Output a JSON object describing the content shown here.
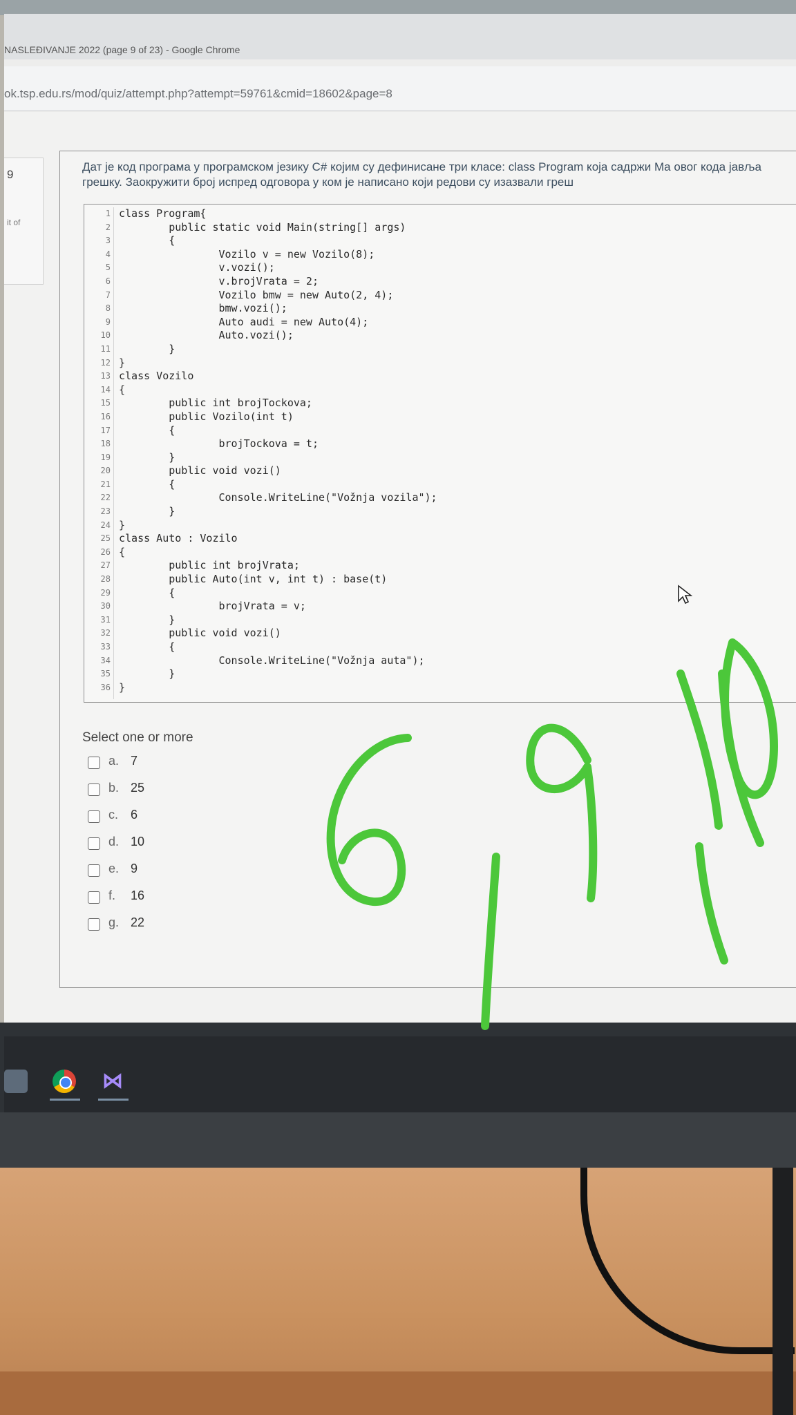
{
  "browser": {
    "title": "NASLEĐIVANJE 2022 (page 9 of 23) - Google Chrome",
    "url": "ok.tsp.edu.rs/mod/quiz/attempt.php?attempt=59761&cmid=18602&page=8"
  },
  "side_panel": {
    "question_number": "9",
    "partial_text": "it of"
  },
  "question": {
    "text": "Дат је код програма у програмском језику C# којим су дефинисане три класе: class Program која садржи Ma овог кода јавља грешку. Заокружити број испред одговора у ком је написано који редови су изазвали греш"
  },
  "code": {
    "lines": [
      {
        "n": "1",
        "text": "class Program{"
      },
      {
        "n": "2",
        "text": "        public static void Main(string[] args)"
      },
      {
        "n": "3",
        "text": "        {"
      },
      {
        "n": "4",
        "text": "                Vozilo v = new Vozilo(8);"
      },
      {
        "n": "5",
        "text": "                v.vozi();"
      },
      {
        "n": "6",
        "text": "                v.brojVrata = 2;"
      },
      {
        "n": "7",
        "text": "                Vozilo bmw = new Auto(2, 4);"
      },
      {
        "n": "8",
        "text": "                bmw.vozi();"
      },
      {
        "n": "9",
        "text": "                Auto audi = new Auto(4);"
      },
      {
        "n": "10",
        "text": "                Auto.vozi();"
      },
      {
        "n": "11",
        "text": "        }"
      },
      {
        "n": "12",
        "text": "}"
      },
      {
        "n": "13",
        "text": "class Vozilo"
      },
      {
        "n": "14",
        "text": "{"
      },
      {
        "n": "15",
        "text": "        public int brojTockova;"
      },
      {
        "n": "16",
        "text": "        public Vozilo(int t)"
      },
      {
        "n": "17",
        "text": "        {"
      },
      {
        "n": "18",
        "text": "                brojTockova = t;"
      },
      {
        "n": "19",
        "text": "        }"
      },
      {
        "n": "20",
        "text": "        public void vozi()"
      },
      {
        "n": "21",
        "text": "        {"
      },
      {
        "n": "22",
        "text": "                Console.WriteLine(\"Vožnja vozila\");"
      },
      {
        "n": "23",
        "text": "        }"
      },
      {
        "n": "24",
        "text": "}"
      },
      {
        "n": "25",
        "text": "class Auto : Vozilo"
      },
      {
        "n": "26",
        "text": "{"
      },
      {
        "n": "27",
        "text": "        public int brojVrata;"
      },
      {
        "n": "28",
        "text": "        public Auto(int v, int t) : base(t)"
      },
      {
        "n": "29",
        "text": "        {"
      },
      {
        "n": "30",
        "text": "                brojVrata = v;"
      },
      {
        "n": "31",
        "text": "        }"
      },
      {
        "n": "32",
        "text": "        public void vozi()"
      },
      {
        "n": "33",
        "text": "        {"
      },
      {
        "n": "34",
        "text": "                Console.WriteLine(\"Vožnja auta\");"
      },
      {
        "n": "35",
        "text": "        }"
      },
      {
        "n": "36",
        "text": "}"
      }
    ]
  },
  "answers": {
    "prompt": "Select one or more",
    "options": [
      {
        "letter": "a.",
        "value": "7",
        "checked": false
      },
      {
        "letter": "b.",
        "value": "25",
        "checked": false
      },
      {
        "letter": "c.",
        "value": "6",
        "checked": false
      },
      {
        "letter": "d.",
        "value": "10",
        "checked": false
      },
      {
        "letter": "e.",
        "value": "9",
        "checked": false
      },
      {
        "letter": "f.",
        "value": "16",
        "checked": false
      },
      {
        "letter": "g.",
        "value": "22",
        "checked": false
      }
    ]
  },
  "annotation": {
    "handwritten_text": "6, 9, 10",
    "color": "#4cc73a"
  },
  "taskbar": {
    "icons": [
      "file-explorer-icon",
      "chrome-icon",
      "visual-studio-icon"
    ]
  }
}
